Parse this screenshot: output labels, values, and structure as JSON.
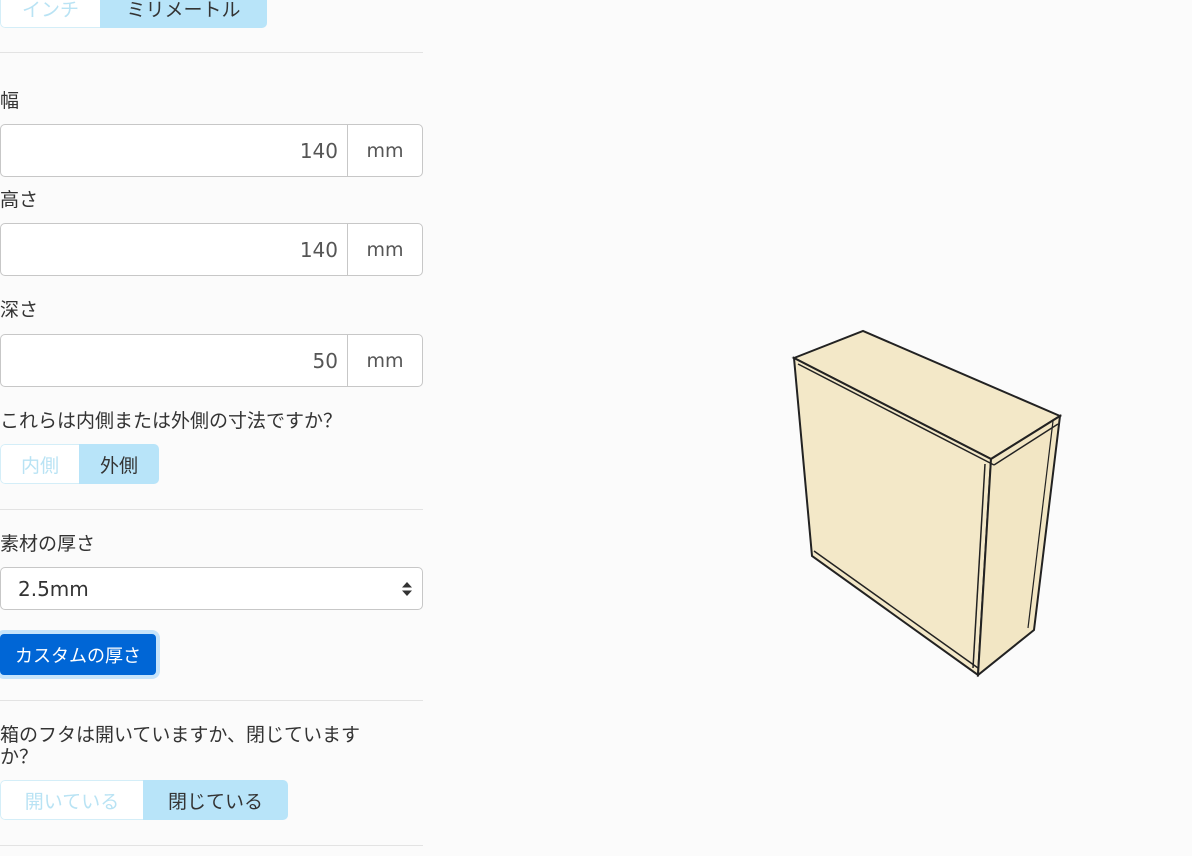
{
  "units": {
    "inch_label": "インチ",
    "mm_label": "ミリメートル",
    "selected": "mm"
  },
  "fields": [
    {
      "label": "幅",
      "value": "140",
      "unit": "mm"
    },
    {
      "label": "高さ",
      "value": "140",
      "unit": "mm"
    },
    {
      "label": "深さ",
      "value": "50",
      "unit": "mm"
    }
  ],
  "dimension_type": {
    "question": "これらは内側または外側の寸法ですか？",
    "inside_label": "内側",
    "outside_label": "外側",
    "selected": "outside"
  },
  "material": {
    "label": "素材の厚さ",
    "selected_value": "2.5mm",
    "custom_button": "カスタムの厚さ"
  },
  "lid": {
    "question_line1": "箱のフタは開いていますか、閉じています",
    "question_line2": "か？",
    "open_label": "開いている",
    "closed_label": "閉じている",
    "selected": "closed"
  },
  "preview": {
    "face_color": "#f3e8c8",
    "edge_color": "#222222"
  }
}
